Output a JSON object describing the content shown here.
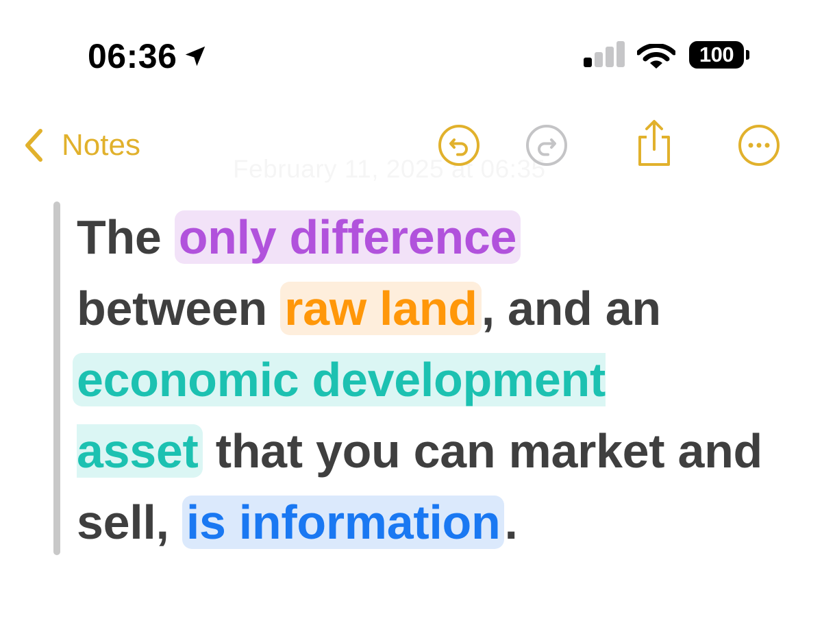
{
  "status_bar": {
    "time": "06:36",
    "battery": "100"
  },
  "nav": {
    "back_label": "Notes",
    "date": "February 11, 2025 at 06:35"
  },
  "note": {
    "segments": [
      {
        "text": "The ",
        "highlight": null
      },
      {
        "text": "only difference",
        "highlight": "purple"
      },
      {
        "text": " between ",
        "highlight": null
      },
      {
        "text": "raw land",
        "highlight": "orange"
      },
      {
        "text": ", and an ",
        "highlight": null
      },
      {
        "text": "economic development asset",
        "highlight": "teal"
      },
      {
        "text": " that you can market and sell, ",
        "highlight": null
      },
      {
        "text": "is information",
        "highlight": "blue"
      },
      {
        "text": ".",
        "highlight": null
      }
    ]
  },
  "colors": {
    "accent": "#e1b12c",
    "body_text": "#3f3f3f",
    "purple_text": "#b152dc",
    "purple_bg": "#f2e2f8",
    "orange_text": "#ff9709",
    "orange_bg": "#feeedc",
    "teal_text": "#1cc1b1",
    "teal_bg": "#dbf6f4",
    "blue_text": "#1a78f2",
    "blue_bg": "#dbe9fc"
  },
  "icons": {
    "location": "location-arrow-icon",
    "signal": "cellular-signal-icon",
    "wifi": "wifi-icon",
    "battery": "battery-icon",
    "back": "chevron-left-icon",
    "undo": "undo-icon",
    "redo": "redo-icon",
    "share": "share-icon",
    "more": "more-icon"
  }
}
